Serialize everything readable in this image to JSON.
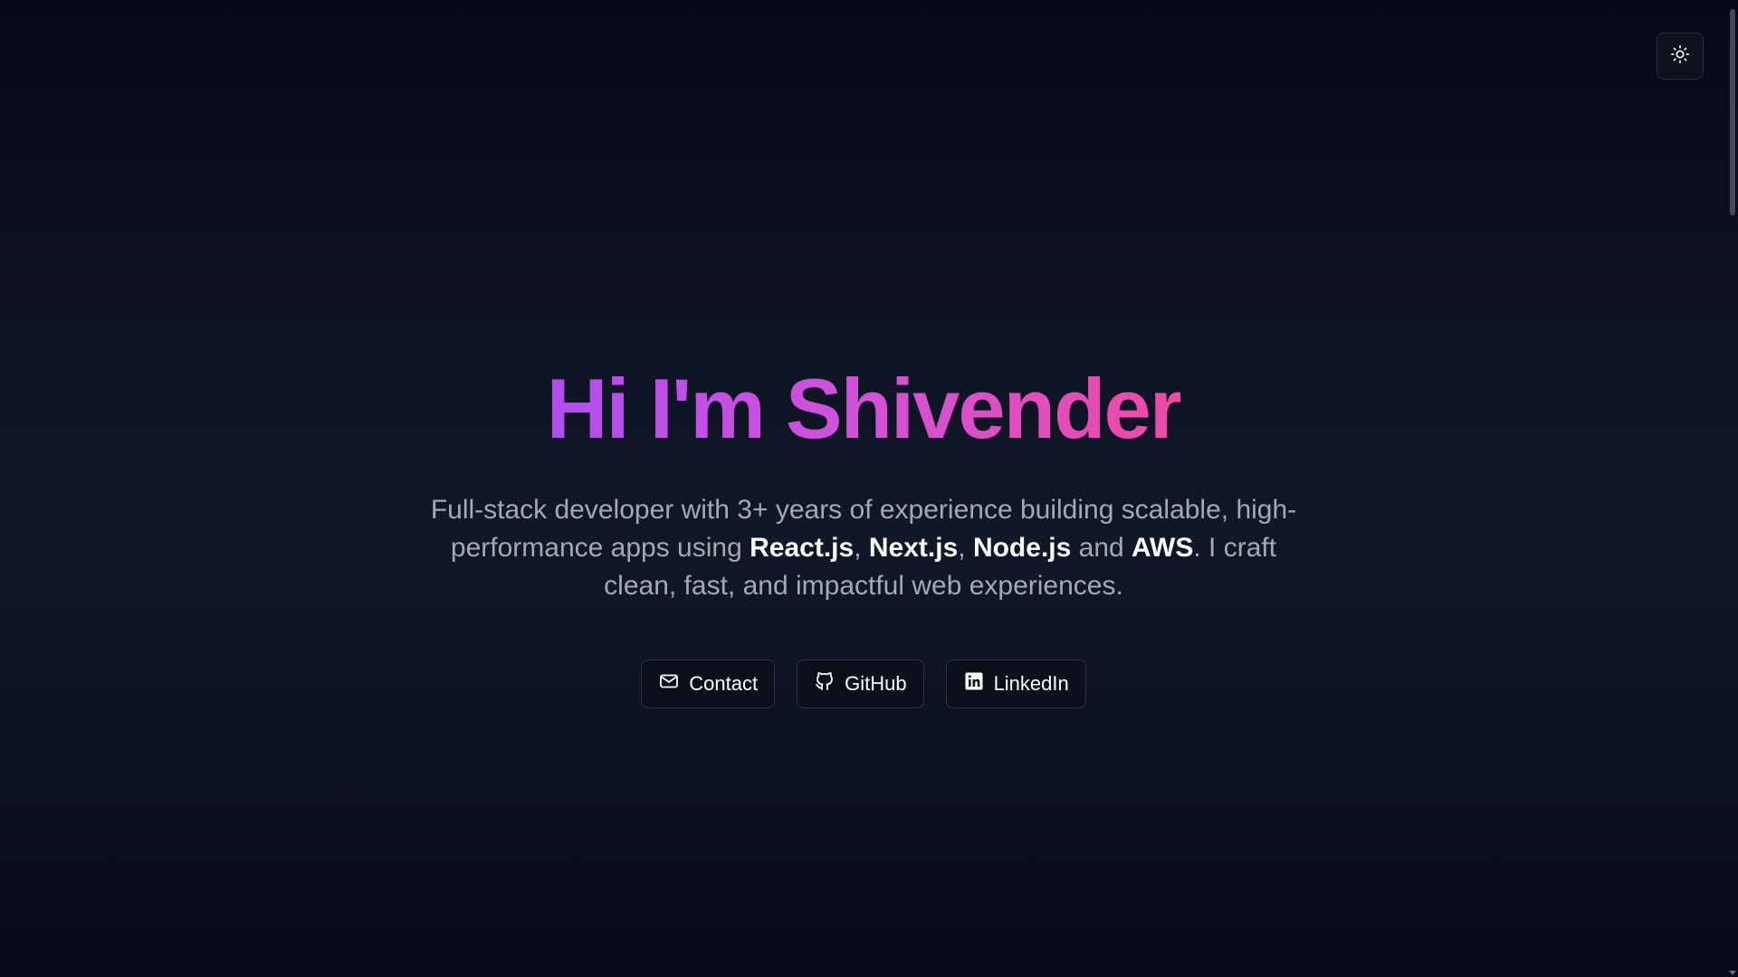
{
  "theme_toggle": {
    "icon": "sun-icon"
  },
  "hero": {
    "title": "Hi I'm Shivender",
    "title_gradient": [
      "#b34df0",
      "#ee4aa4"
    ],
    "description": {
      "part1": "Full-stack developer with 3+ years of experience building scalable, high-performance apps using ",
      "tech1": "React.js",
      "sep1": ", ",
      "tech2": "Next.js",
      "sep2": ", ",
      "tech3": "Node.js",
      "sep3": " and ",
      "tech4": "AWS",
      "part2": ". I craft clean, fast, and impactful web experiences."
    }
  },
  "actions": [
    {
      "label": "Contact",
      "icon": "mail-icon"
    },
    {
      "label": "GitHub",
      "icon": "github-icon"
    },
    {
      "label": "LinkedIn",
      "icon": "linkedin-icon"
    }
  ],
  "colors": {
    "background": "#0f1424",
    "muted_text": "#a4a9b4",
    "button_border": "#2e3342"
  }
}
